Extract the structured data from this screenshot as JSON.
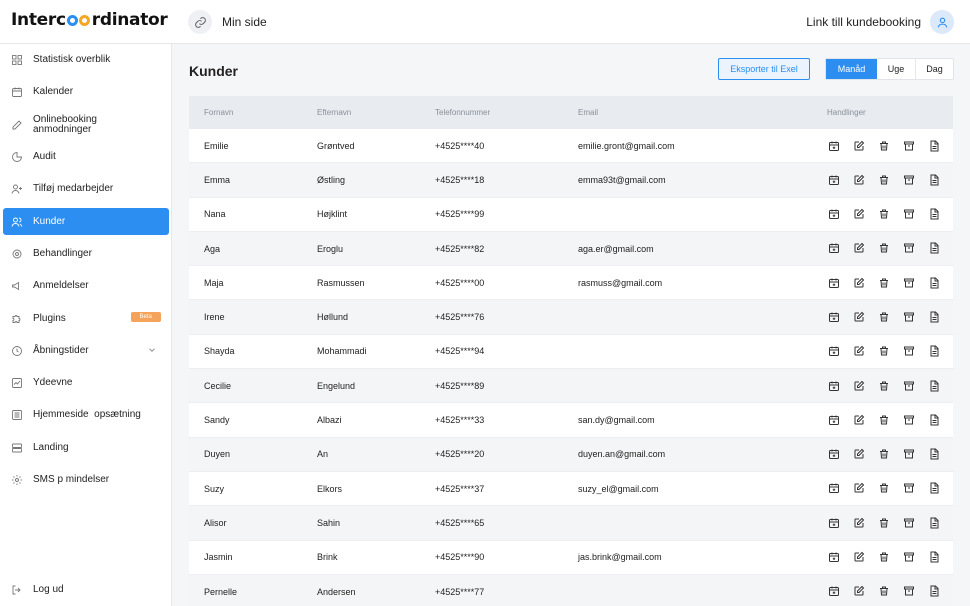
{
  "header": {
    "logo_left": "Interc",
    "logo_right": "rdinator",
    "min_side": "Min side",
    "booking_link": "Link till kundebooking"
  },
  "sidebar": {
    "items": [
      {
        "label": "Statistisk overblik",
        "icon": "grid-icon"
      },
      {
        "label": "Kalender",
        "icon": "calendar-icon"
      },
      {
        "label": "Onlinebooking anmodninger",
        "icon": "edit-icon"
      },
      {
        "label": "Audit",
        "icon": "pie-icon"
      },
      {
        "label": "Tilføj medarbejder",
        "icon": "user-add-icon"
      },
      {
        "label": "Kunder",
        "icon": "users-icon"
      },
      {
        "label": "Behandlinger",
        "icon": "treatment-icon"
      },
      {
        "label": "Anmeldelser",
        "icon": "megaphone-icon"
      },
      {
        "label": "Plugins",
        "icon": "puzzle-icon",
        "badge": "Beta"
      },
      {
        "label": "Åbningstider",
        "icon": "clock-icon"
      },
      {
        "label": "Ydeevne",
        "icon": "chart-icon"
      },
      {
        "label": "Hjemmeside  opsætning",
        "icon": "layout-icon"
      },
      {
        "label": "Landing",
        "icon": "server-icon"
      },
      {
        "label": "SMS p mindelser",
        "icon": "gear-icon"
      }
    ],
    "logout": "Log ud"
  },
  "main": {
    "title": "Kunder",
    "export_label": "Eksporter til Exel",
    "view_month": "Manåd",
    "view_week": "Uge",
    "view_day": "Dag"
  },
  "table": {
    "headers": [
      "Fornavn",
      "Efternavn",
      "Telefonnummer",
      "Email",
      "Handlinger"
    ],
    "rows": [
      {
        "first": "Emilie",
        "last": "Grøntved",
        "phone": "+4525****40",
        "email": "emilie.gront@gmail.com"
      },
      {
        "first": "Emma",
        "last": "Østling",
        "phone": "+4525****18",
        "email": "emma93t@gmail.com"
      },
      {
        "first": "Nana",
        "last": "Højklint",
        "phone": "+4525****99",
        "email": ""
      },
      {
        "first": "Aga",
        "last": "Eroglu",
        "phone": "+4525****82",
        "email": "aga.er@gmail.com"
      },
      {
        "first": "Maja",
        "last": "Rasmussen",
        "phone": "+4525****00",
        "email": "rasmuss@gmail.com"
      },
      {
        "first": "Irene",
        "last": "Høllund",
        "phone": "+4525****76",
        "email": ""
      },
      {
        "first": "Shayda",
        "last": "Mohammadi",
        "phone": "+4525****94",
        "email": ""
      },
      {
        "first": "Cecilie",
        "last": "Engelund",
        "phone": "+4525****89",
        "email": ""
      },
      {
        "first": "Sandy",
        "last": "Albazi",
        "phone": "+4525****33",
        "email": "san.dy@gmail.com"
      },
      {
        "first": "Duyen",
        "last": "An",
        "phone": "+4525****20",
        "email": "duyen.an@gmail.com"
      },
      {
        "first": "Suzy",
        "last": "Elkors",
        "phone": "+4525****37",
        "email": "suzy_el@gmail.com"
      },
      {
        "first": "Alisor",
        "last": "Sahin",
        "phone": "+4525****65",
        "email": ""
      },
      {
        "first": "Jasmin",
        "last": "Brink",
        "phone": "+4525****90",
        "email": "jas.brink@gmail.com"
      },
      {
        "first": "Pernelle",
        "last": "Andersen",
        "phone": "+4525****77",
        "email": ""
      }
    ],
    "action_icons": [
      "calendar-add-icon",
      "edit-icon",
      "trash-icon",
      "archive-icon",
      "document-icon"
    ]
  },
  "colors": {
    "accent": "#2b8ef0",
    "beta": "#f5a35a",
    "logo_orange": "#f5a623"
  }
}
